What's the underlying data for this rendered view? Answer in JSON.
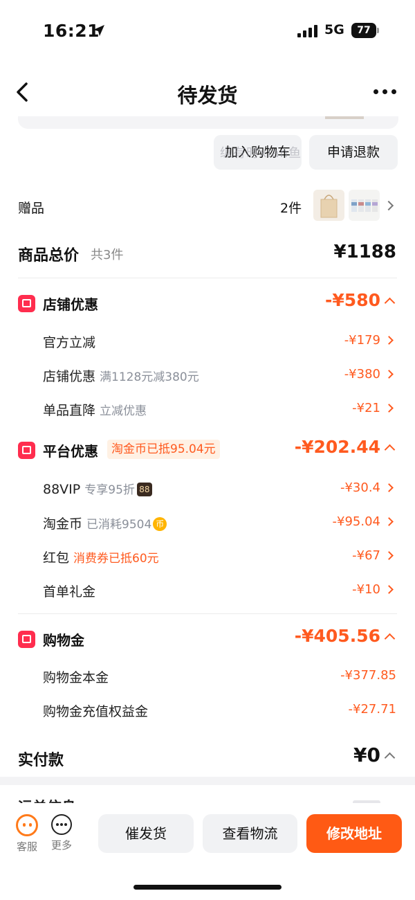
{
  "status_bar": {
    "time": "16:21",
    "network": "5G",
    "battery": "77"
  },
  "nav": {
    "title": "待发货"
  },
  "actions": {
    "add_to_cart": "加入购物车",
    "refund": "申请退款",
    "watermark": "纵有时xian鱼"
  },
  "gift": {
    "label": "赠品",
    "count": "2件"
  },
  "total": {
    "label": "商品总价",
    "count": "共3件",
    "value": "¥1188"
  },
  "store_discount": {
    "label": "店铺优惠",
    "amount": "-¥580",
    "items": [
      {
        "label": "官方立减",
        "sub": "",
        "amount": "-¥179"
      },
      {
        "label": "店铺优惠",
        "sub": "满1128元减380元",
        "amount": "-¥380"
      },
      {
        "label": "单品直降",
        "sub": "立减优惠",
        "amount": "-¥21"
      }
    ]
  },
  "platform_discount": {
    "label": "平台优惠",
    "tag": "淘金币已抵95.04元",
    "amount": "-¥202.44",
    "items": [
      {
        "label": "88VIP",
        "sub": "专享95折",
        "badge": "88",
        "amount": "-¥30.4"
      },
      {
        "label": "淘金币",
        "sub": "已消耗9504",
        "badge": "币",
        "amount": "-¥95.04"
      },
      {
        "label": "红包",
        "sub": "消费券已抵60元",
        "amount": "-¥67"
      },
      {
        "label": "首单礼金",
        "sub": "",
        "amount": "-¥10"
      }
    ]
  },
  "shopping_gold": {
    "label": "购物金",
    "amount": "-¥405.56",
    "items": [
      {
        "label": "购物金本金",
        "amount": "-¥377.85"
      },
      {
        "label": "购物金充值权益金",
        "amount": "-¥27.71"
      }
    ]
  },
  "paid": {
    "label": "实付款",
    "value": "¥0"
  },
  "peek": {
    "text": "运单信息"
  },
  "bottom": {
    "service_label": "客服",
    "more_label": "更多",
    "remind": "催发货",
    "logistics": "查看物流",
    "change_address": "修改地址"
  },
  "colors": {
    "accent": "#ff5a1f",
    "primary_button": "#ff5a14",
    "group_icon": "#ff2d4e"
  }
}
